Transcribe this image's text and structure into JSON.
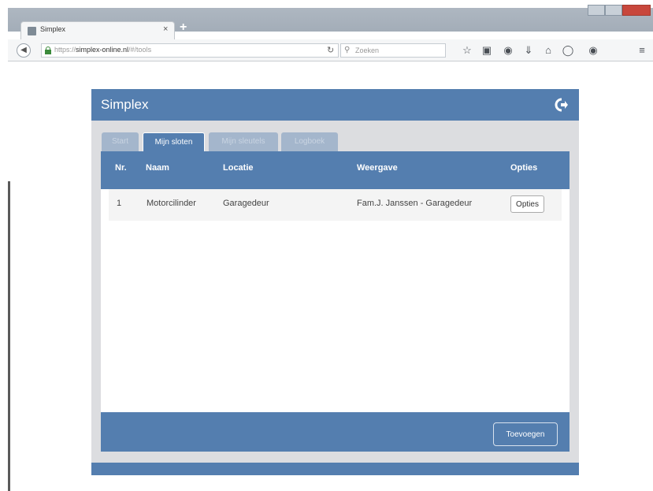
{
  "browser": {
    "tab_title": "Simplex",
    "tab_close": "×",
    "new_tab": "+",
    "url_protocol": "https://",
    "url_domain": "simplex-online.nl",
    "url_path": "/#/tools",
    "search_placeholder": "Zoeken"
  },
  "app": {
    "title": "Simplex",
    "tabs": [
      {
        "label": "Start"
      },
      {
        "label": "Mijn sloten"
      },
      {
        "label": "Mijn sleutels"
      },
      {
        "label": "Logboek"
      }
    ],
    "table": {
      "headers": [
        "Nr.",
        "Naam",
        "Locatie",
        "Weergave",
        "Opties"
      ],
      "rows": [
        {
          "nr": "1",
          "naam": "Motorcilinder",
          "locatie": "Garagedeur",
          "weergave": "Fam.J. Janssen - Garagedeur",
          "optie_button": "Opties"
        }
      ]
    },
    "add_button": "Toevoegen",
    "accent_color": "#547eaf"
  }
}
